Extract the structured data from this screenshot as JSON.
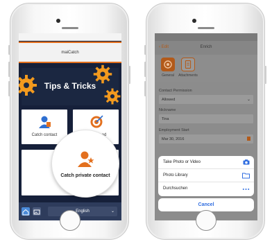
{
  "left_screen": {
    "header_title": "maiCatch",
    "banner_title": "Tips & Tricks",
    "tiles": [
      {
        "label": "Catch contact"
      },
      {
        "label": "Catch Lead"
      }
    ],
    "magnifier_label": "Catch private contact",
    "language": "English"
  },
  "right_screen": {
    "nav": {
      "back_label": "Edit",
      "title": "Enrich"
    },
    "tabs": [
      {
        "label": "General"
      },
      {
        "label": "Attachments"
      }
    ],
    "fields": [
      {
        "label": "Contact Permission",
        "value": "Allowed"
      },
      {
        "label": "Nickname",
        "value": "Tina"
      },
      {
        "label": "Employment Start",
        "value": "Mar 30, 2016"
      }
    ],
    "action_sheet": {
      "options": [
        {
          "label": "Take Photo or Video",
          "icon": "camera-icon"
        },
        {
          "label": "Photo Library",
          "icon": "folder-icon"
        },
        {
          "label": "Durchsuchen",
          "icon": "more-icon"
        }
      ],
      "cancel_label": "Cancel"
    }
  },
  "colors": {
    "accent_orange": "#e3701e",
    "dark_navy": "#16203a",
    "ios_blue": "#2f6de0"
  }
}
